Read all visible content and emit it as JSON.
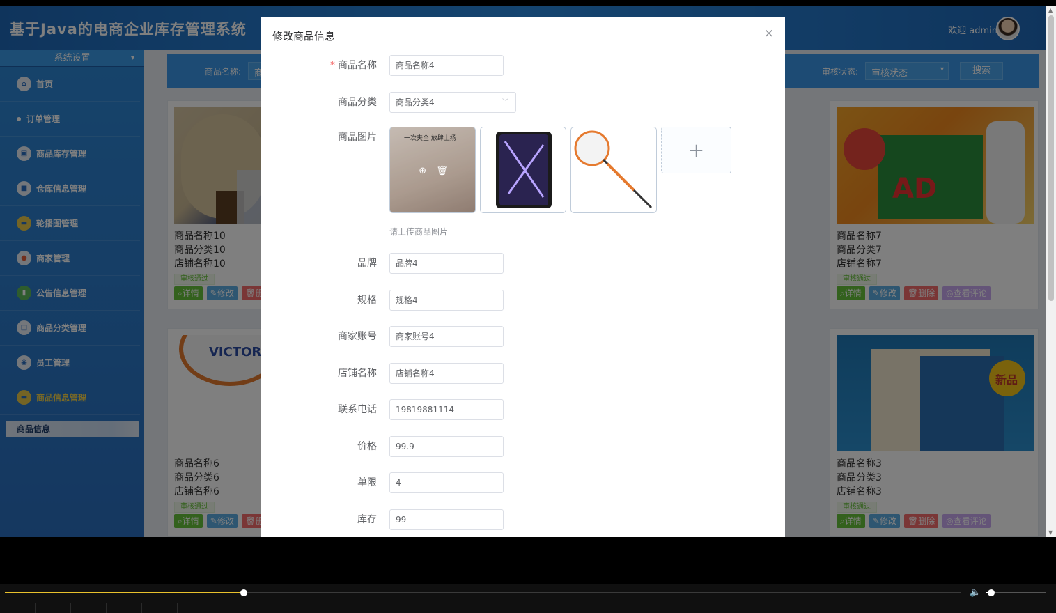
{
  "header": {
    "title": "基于Java的电商企业库存管理系统",
    "welcome": "欢迎 admin"
  },
  "sidebar": {
    "section": "系统设置",
    "items": [
      {
        "label": "首页",
        "icon": "home-icon"
      },
      {
        "label": "订单管理",
        "icon": "dot-icon"
      },
      {
        "label": "商品库存管理",
        "icon": "box-icon"
      },
      {
        "label": "仓库信息管理",
        "icon": "warehouse-icon"
      },
      {
        "label": "轮播图管理",
        "icon": "image-icon"
      },
      {
        "label": "商家管理",
        "icon": "user-icon"
      },
      {
        "label": "公告信息管理",
        "icon": "notice-icon"
      },
      {
        "label": "商品分类管理",
        "icon": "category-icon"
      },
      {
        "label": "员工管理",
        "icon": "staff-icon"
      },
      {
        "label": "商品信息管理",
        "icon": "product-icon"
      }
    ],
    "sub_item": "商品信息"
  },
  "search": {
    "name_label": "商品名称:",
    "name_value": "商",
    "status_label": "审核状态:",
    "status_value": "审核状态",
    "search_button": "搜索"
  },
  "cards": [
    {
      "name": "商品名称10",
      "category": "商品分类10",
      "shop": "店铺名称10",
      "status": "审核通过"
    },
    {
      "name": "商品名称7",
      "category": "商品分类7",
      "shop": "店铺名称7",
      "status": "审核通过"
    },
    {
      "name": "商品名称6",
      "category": "商品分类6",
      "shop": "店铺名称6",
      "status": "审核通过"
    },
    {
      "name": "商品名称3",
      "category": "商品分类3",
      "shop": "店铺名称3",
      "status": "审核通过"
    }
  ],
  "card_actions": {
    "detail": "详情",
    "edit": "修改",
    "delete": "删除",
    "comments": "查看评论"
  },
  "modal": {
    "title": "修改商品信息",
    "close": "×",
    "image_label": "商品图片",
    "image_hint": "请上传商品图片",
    "preview_tile_text": "一次夹全 放肆上扬",
    "fields": [
      {
        "label": "商品名称",
        "value": "商品名称4",
        "required": "*"
      },
      {
        "label": "商品分类",
        "value": "商品分类4"
      },
      {
        "label": "品牌",
        "value": "品牌4"
      },
      {
        "label": "规格",
        "value": "规格4"
      },
      {
        "label": "商家账号",
        "value": "商家账号4"
      },
      {
        "label": "店铺名称",
        "value": "店铺名称4"
      },
      {
        "label": "联系电话",
        "value": "19819881114"
      },
      {
        "label": "价格",
        "value": "99.9"
      },
      {
        "label": "单限",
        "value": "4"
      },
      {
        "label": "库存",
        "value": "99"
      }
    ]
  },
  "player": {
    "progress": 0.25,
    "volume": 0.08
  }
}
